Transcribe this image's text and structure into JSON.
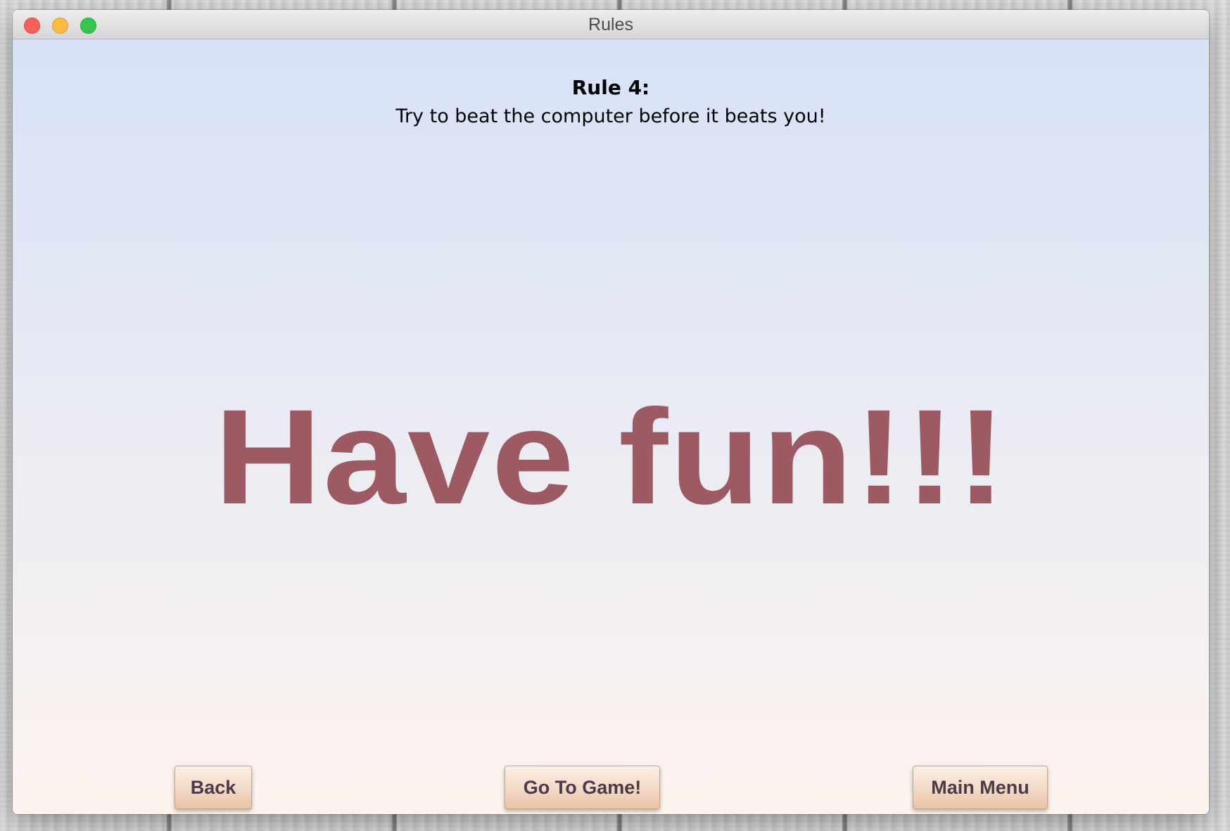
{
  "window": {
    "title": "Rules"
  },
  "rule": {
    "heading": "Rule 4:",
    "text": "Try to beat the computer before it beats you!"
  },
  "message": "Have fun!!!",
  "buttons": {
    "back": "Back",
    "go_to_game": "Go To Game!",
    "main_menu": "Main Menu"
  },
  "colors": {
    "message": "#9e5a62",
    "button_text": "#4b3a48",
    "close": "#fc605c",
    "minimize": "#fdbc40",
    "maximize": "#34c84a"
  }
}
